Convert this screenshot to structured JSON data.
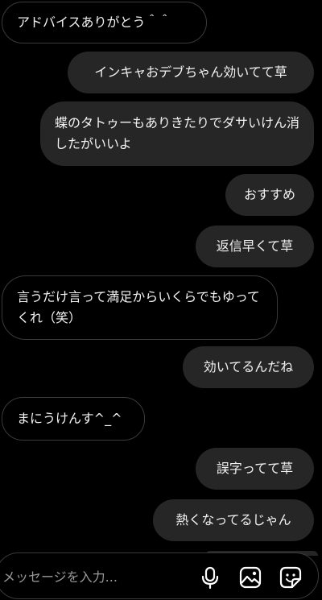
{
  "messages": [
    {
      "id": "m1",
      "side": "received",
      "text": "アドバイスありがとう＾＾"
    },
    {
      "id": "m2",
      "side": "sent",
      "text": "インキャおデブちゃん効いてて草"
    },
    {
      "id": "m3",
      "side": "sent",
      "text": "蝶のタトゥーもありきたりでダサいけん消したがいいよ"
    },
    {
      "id": "m4",
      "side": "sent",
      "text": "おすすめ"
    },
    {
      "id": "m5",
      "side": "sent",
      "text": "返信早くて草"
    },
    {
      "id": "m6",
      "side": "received",
      "text": "言うだけ言って満足からいくらでもゆってくれ（笑）"
    },
    {
      "id": "m7",
      "side": "sent",
      "text": "効いてるんだね"
    },
    {
      "id": "m8",
      "side": "received",
      "text": "まにうけんす^_^"
    },
    {
      "id": "m9",
      "side": "sent",
      "text": "誤字ってて草"
    },
    {
      "id": "m10",
      "side": "sent",
      "text": "熱くなってるじゃん"
    }
  ],
  "composer": {
    "placeholder": "メッセージを入力...",
    "icons": [
      "microphone-icon",
      "image-icon",
      "sticker-icon"
    ]
  },
  "colors": {
    "background": "#000000",
    "sent_bubble": "#262626",
    "received_border": "#3a3a3a",
    "text": "#f2f2f2",
    "placeholder": "#9a9a9a"
  }
}
